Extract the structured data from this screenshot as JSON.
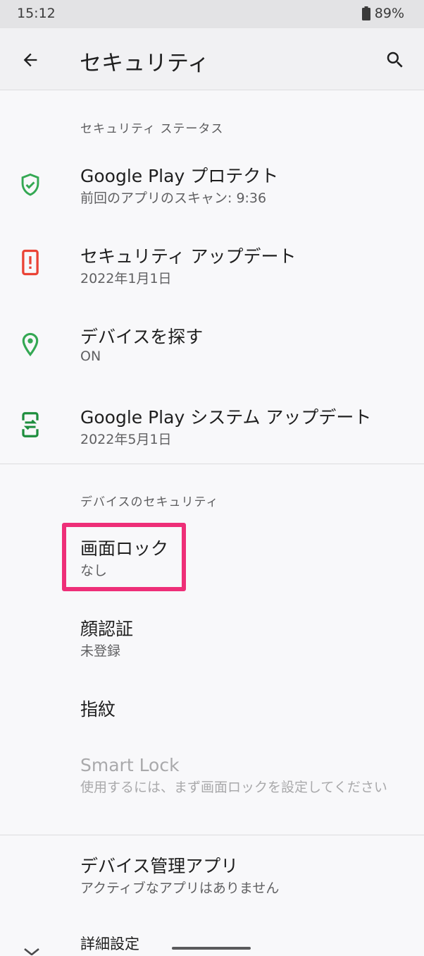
{
  "status_bar": {
    "time": "15:12",
    "battery": "89%"
  },
  "app_bar": {
    "title": "セキュリティ"
  },
  "sections": {
    "security_status": {
      "header": "セキュリティ ステータス",
      "items": [
        {
          "title": "Google Play プロテクト",
          "subtitle": "前回のアプリのスキャン: 9:36",
          "icon": "shield-check-icon",
          "color": "#34a853"
        },
        {
          "title": "セキュリティ アップデート",
          "subtitle": "2022年1月1日",
          "icon": "phone-alert-icon",
          "color": "#ea4335"
        },
        {
          "title": "デバイスを探す",
          "subtitle": "ON",
          "icon": "location-pin-icon",
          "color": "#34a853"
        },
        {
          "title": "Google Play システム アップデート",
          "subtitle": "2022年5月1日",
          "icon": "system-update-icon",
          "color": "#1e8e3e"
        }
      ]
    },
    "device_security": {
      "header": "デバイスのセキュリティ",
      "items": [
        {
          "title": "画面ロック",
          "subtitle": "なし"
        },
        {
          "title": "顔認証",
          "subtitle": "未登録"
        },
        {
          "title": "指紋"
        },
        {
          "title": "Smart Lock",
          "subtitle": "使用するには、まず画面ロックを設定してください"
        }
      ]
    },
    "more": {
      "items": [
        {
          "title": "デバイス管理アプリ",
          "subtitle": "アクティブなアプリはありません"
        },
        {
          "title": "詳細設定"
        }
      ]
    }
  },
  "colors": {
    "highlight": "#ee2f78",
    "accent_green": "#34a853",
    "alert_red": "#ea4335"
  }
}
